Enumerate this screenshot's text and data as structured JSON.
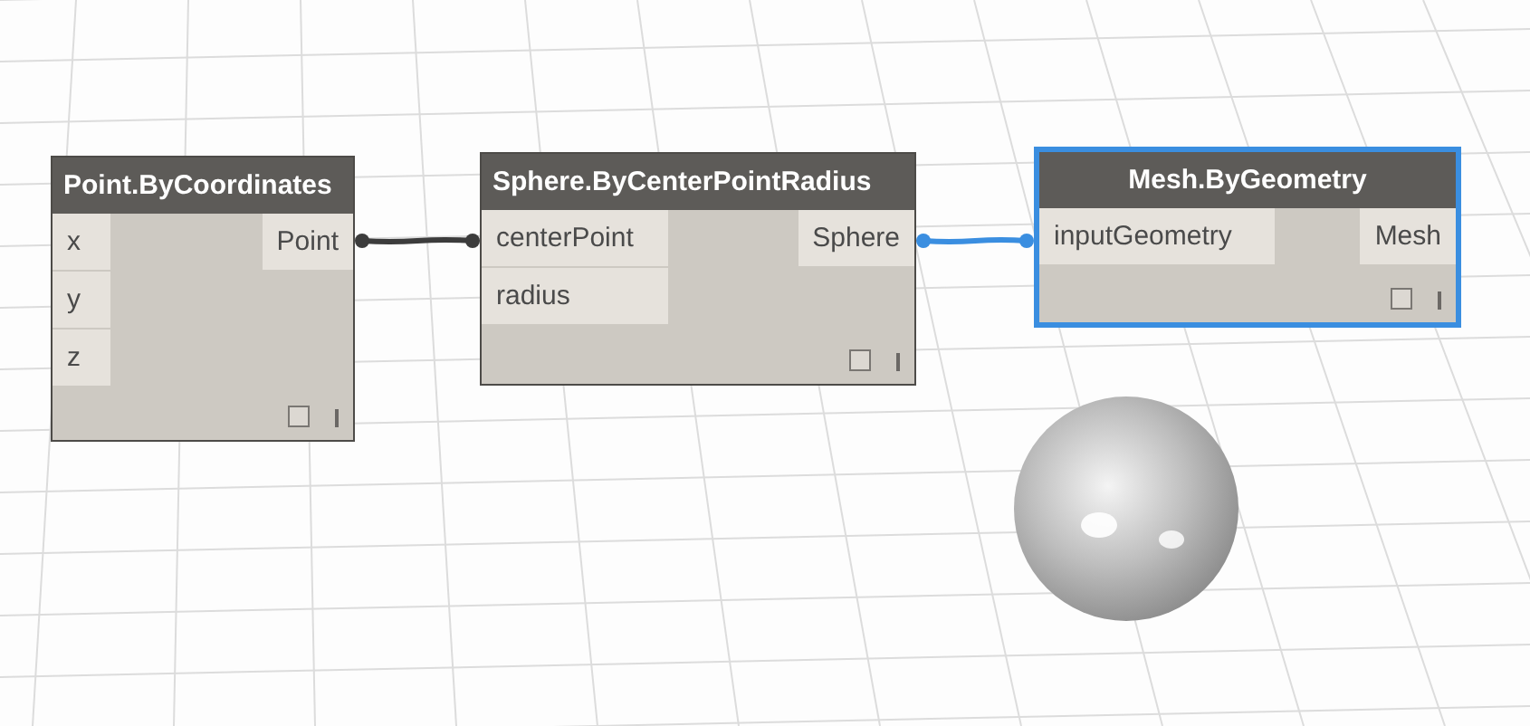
{
  "nodes": [
    {
      "title": "Point.ByCoordinates",
      "selected": false,
      "inputs": [
        "x",
        "y",
        "z"
      ],
      "outputs": [
        "Point"
      ]
    },
    {
      "title": "Sphere.ByCenterPointRadius",
      "selected": false,
      "inputs": [
        "centerPoint",
        "radius"
      ],
      "outputs": [
        "Sphere"
      ]
    },
    {
      "title": "Mesh.ByGeometry",
      "selected": true,
      "inputs": [
        "inputGeometry"
      ],
      "outputs": [
        "Mesh"
      ]
    }
  ],
  "connections": [
    {
      "selected": false
    },
    {
      "selected": true
    }
  ],
  "preview": {
    "kind": "sphere"
  }
}
